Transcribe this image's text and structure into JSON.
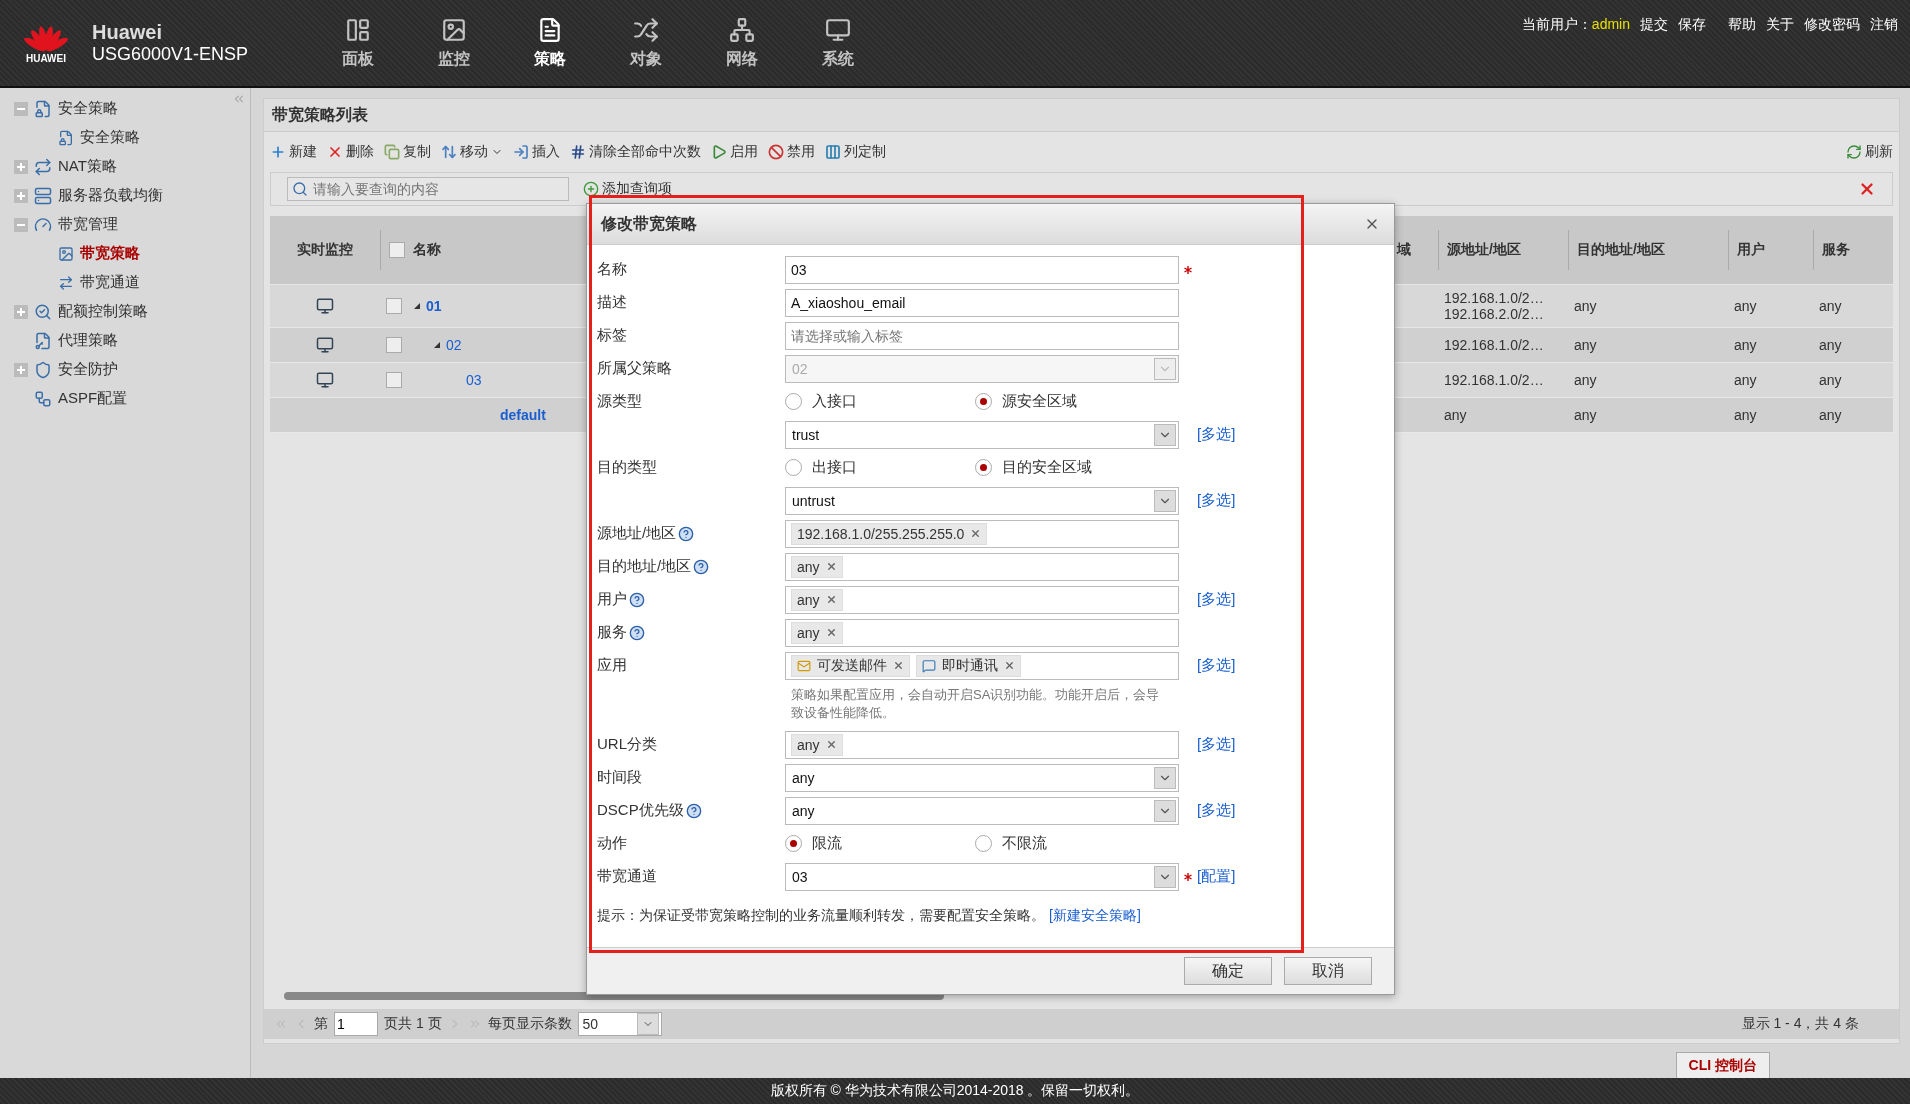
{
  "header": {
    "brand": "Huawei",
    "logo_text": "HUAWEI",
    "model": "USG6000V1-ENSP",
    "nav": [
      {
        "label": "面板",
        "selected": false
      },
      {
        "label": "监控",
        "selected": false
      },
      {
        "label": "策略",
        "selected": true
      },
      {
        "label": "对象",
        "selected": false
      },
      {
        "label": "网络",
        "selected": false
      },
      {
        "label": "系统",
        "selected": false
      }
    ],
    "user_label": "当前用户：",
    "user": "admin",
    "links": [
      "提交",
      "保存",
      "帮助",
      "关于",
      "修改密码",
      "注销"
    ]
  },
  "sidebar": {
    "items": [
      {
        "label": "安全策略",
        "expanded": true,
        "selected": false,
        "children": [
          {
            "label": "安全策略",
            "selected": false
          }
        ]
      },
      {
        "label": "NAT策略",
        "expanded": false,
        "selected": false
      },
      {
        "label": "服务器负载均衡",
        "expanded": false,
        "selected": false
      },
      {
        "label": "带宽管理",
        "expanded": true,
        "selected": false,
        "children": [
          {
            "label": "带宽策略",
            "selected": true
          },
          {
            "label": "带宽通道",
            "selected": false
          }
        ]
      },
      {
        "label": "配额控制策略",
        "expanded": false,
        "selected": false
      },
      {
        "label": "代理策略",
        "selected": false
      },
      {
        "label": "安全防护",
        "expanded": false,
        "selected": false
      },
      {
        "label": "ASPF配置",
        "selected": false
      }
    ]
  },
  "panel": {
    "title": "带宽策略列表",
    "toolbar": [
      {
        "label": "新建"
      },
      {
        "label": "删除"
      },
      {
        "label": "复制"
      },
      {
        "label": "移动",
        "menu": true
      },
      {
        "label": "插入"
      },
      {
        "label": "清除全部命中次数"
      },
      {
        "label": "启用"
      },
      {
        "label": "禁用"
      },
      {
        "label": "列定制"
      }
    ],
    "refresh": "刷新",
    "search": {
      "placeholder": "请输入要查询的内容"
    },
    "add_query": "添加查询项",
    "table": {
      "columns": [
        "实时监控",
        "名称",
        "域",
        "源地址/地区",
        "目的地址/地区",
        "用户",
        "服务"
      ],
      "header_checked": false,
      "rows": [
        {
          "name": "01",
          "expanded": true,
          "checked": false,
          "source": [
            "192.168.1.0/2…",
            "192.168.2.0/2…"
          ],
          "destination": "any",
          "user": "any",
          "service": "any",
          "children": [
            {
              "name": "02",
              "expanded": true,
              "checked": false,
              "source": [
                "192.168.1.0/2…"
              ],
              "destination": "any",
              "user": "any",
              "service": "any",
              "children": [
                {
                  "name": "03",
                  "checked": false,
                  "source": [
                    "192.168.1.0/2…"
                  ],
                  "destination": "any",
                  "user": "any",
                  "service": "any"
                }
              ]
            }
          ]
        },
        {
          "kind": "default",
          "name": "default",
          "source": [
            "any"
          ],
          "destination": "any",
          "user": "any",
          "service": "any"
        }
      ]
    },
    "pagination": {
      "page_prefix": "第",
      "page": "1",
      "page_suffix": "页共 1 页",
      "per_page_label": "每页显示条数",
      "per_page": "50",
      "summary": "显示 1 - 4，共 4 条"
    }
  },
  "dialog": {
    "title": "修改带宽策略",
    "fields": [
      {
        "label": "名称",
        "kind": "text",
        "value": "03",
        "help": false,
        "required": true
      },
      {
        "label": "描述",
        "kind": "text",
        "value": "A_xiaoshou_email",
        "help": false,
        "required": false
      },
      {
        "label": "标签",
        "kind": "text",
        "placeholder": "请选择或输入标签",
        "help": false,
        "required": false
      },
      {
        "label": "所属父策略",
        "kind": "select",
        "value": "02",
        "disabled": true,
        "help": false,
        "required": false
      },
      {
        "label": "源类型",
        "kind": "radio",
        "options": [
          {
            "label": "入接口",
            "selected": false
          },
          {
            "label": "源安全区域",
            "selected": true
          }
        ],
        "help": false,
        "required": false
      },
      {
        "kind": "select",
        "value": "trust",
        "disabled": false,
        "link": "[多选]"
      },
      {
        "label": "目的类型",
        "kind": "radio",
        "options": [
          {
            "label": "出接口",
            "selected": false
          },
          {
            "label": "目的安全区域",
            "selected": true
          }
        ],
        "help": false,
        "required": false
      },
      {
        "kind": "select",
        "value": "untrust",
        "disabled": false,
        "link": "[多选]"
      },
      {
        "label": "源地址/地区",
        "kind": "tags",
        "tags": [
          {
            "text": "192.168.1.0/255.255.255.0",
            "app": false
          }
        ],
        "help": true,
        "required": false
      },
      {
        "label": "目的地址/地区",
        "kind": "tags",
        "tags": [
          {
            "text": "any",
            "app": false
          }
        ],
        "help": true,
        "required": false
      },
      {
        "label": "用户",
        "kind": "tags",
        "tags": [
          {
            "text": "any",
            "app": false
          }
        ],
        "help": true,
        "required": false,
        "link": "[多选]"
      },
      {
        "label": "服务",
        "kind": "tags",
        "tags": [
          {
            "text": "any",
            "app": false
          }
        ],
        "help": true,
        "required": false
      },
      {
        "label": "应用",
        "kind": "tags",
        "tags": [
          {
            "text": "可发送邮件",
            "app": true
          },
          {
            "text": "即时通讯",
            "app": true
          }
        ],
        "help": false,
        "required": false,
        "link": "[多选]"
      },
      {
        "kind": "note",
        "text": "策略如果配置应用，会自动开启SA识别功能。功能开启后，会导致设备性能降低。"
      },
      {
        "label": "URL分类",
        "kind": "tags",
        "tags": [
          {
            "text": "any",
            "app": false
          }
        ],
        "help": false,
        "required": false,
        "link": "[多选]"
      },
      {
        "label": "时间段",
        "kind": "select",
        "value": "any",
        "disabled": false,
        "help": false,
        "required": false
      },
      {
        "label": "DSCP优先级",
        "kind": "select",
        "value": "any",
        "disabled": false,
        "help": true,
        "required": false,
        "link": "[多选]"
      },
      {
        "label": "动作",
        "kind": "radio",
        "options": [
          {
            "label": "限流",
            "selected": true
          },
          {
            "label": "不限流",
            "selected": false
          }
        ],
        "help": false,
        "required": false
      },
      {
        "label": "带宽通道",
        "kind": "select",
        "value": "03",
        "disabled": false,
        "help": false,
        "required": true,
        "link": "[配置]"
      }
    ],
    "hint": {
      "text": "提示：为保证受带宽策略控制的业务流量顺利转发，需要配置安全策略。",
      "link": "[新建安全策略]"
    },
    "buttons": [
      "确定",
      "取消"
    ]
  },
  "cli_tab": "CLI 控制台",
  "footer": "版权所有 © 华为技术有限公司2014-2018 。保留一切权利。"
}
